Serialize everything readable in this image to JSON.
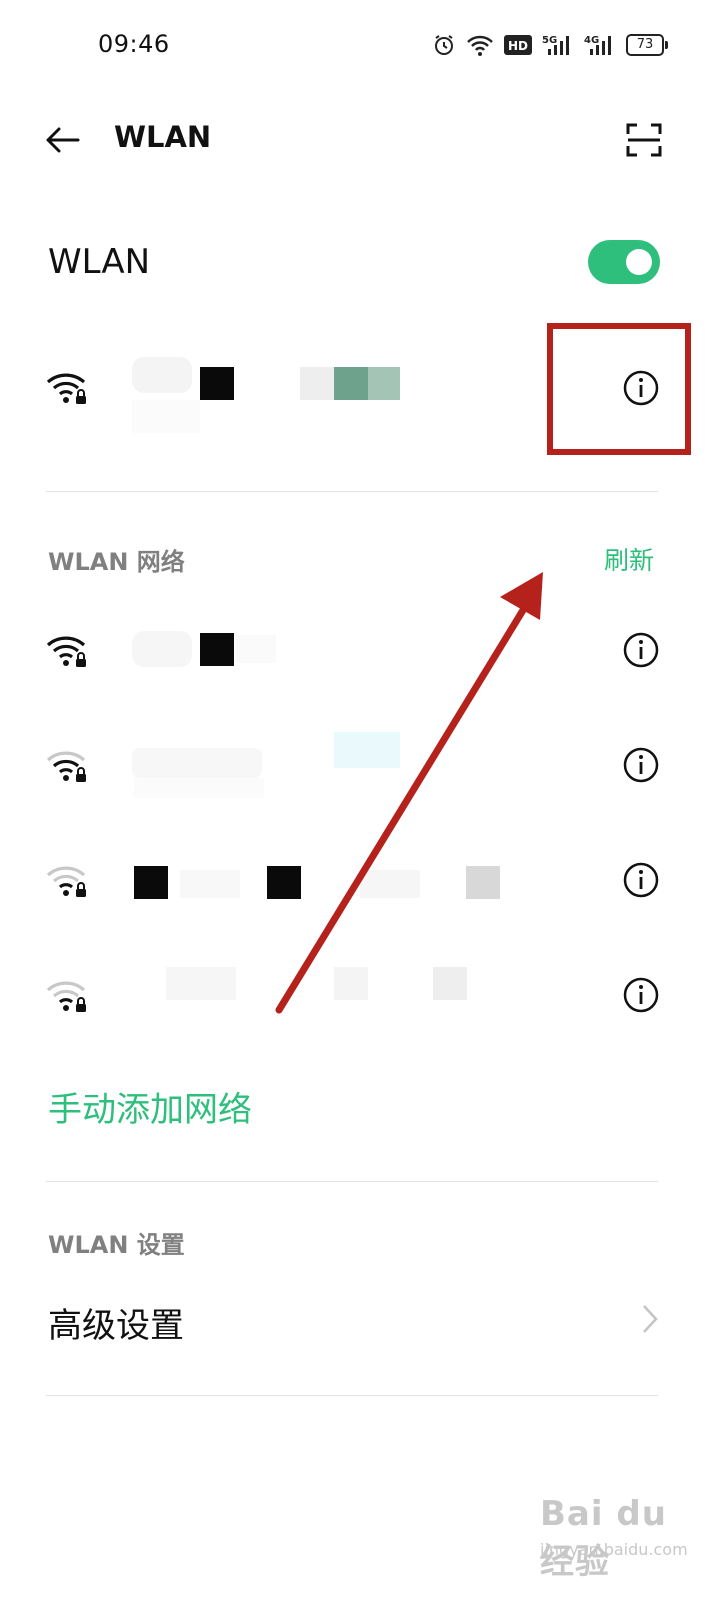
{
  "status_bar": {
    "time": "09:46",
    "hd_label": "HD",
    "net1_label": "5G",
    "net2_label": "4G",
    "battery": "73"
  },
  "header": {
    "title": "WLAN",
    "back_icon": "arrow-left-icon",
    "scan_icon": "scan-qr-icon"
  },
  "wlan_toggle": {
    "label": "WLAN",
    "on": true,
    "color": "#2dbf7b"
  },
  "networks_section": {
    "title": "WLAN 网络",
    "refresh_label": "刷新"
  },
  "add_network_label": "手动添加网络",
  "settings_section": {
    "title": "WLAN 设置",
    "advanced_label": "高级设置"
  },
  "annotation_color": "#b5211b",
  "watermark": {
    "brand": "Bai du 经验",
    "url": "jingyan.baidu.com"
  }
}
